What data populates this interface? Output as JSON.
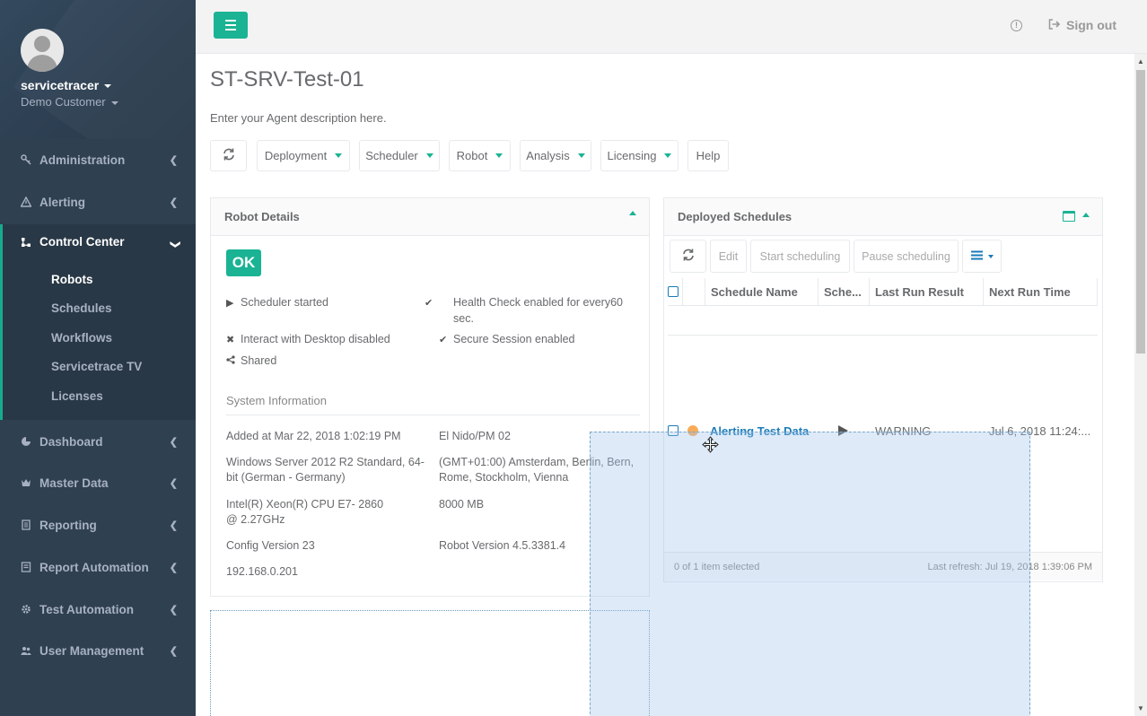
{
  "user": {
    "name": "servicetracer",
    "customer": "Demo Customer"
  },
  "nav": {
    "administration": "Administration",
    "alerting": "Alerting",
    "control_center": "Control Center",
    "control_center_items": [
      "Robots",
      "Schedules",
      "Workflows",
      "Servicetrace TV",
      "Licenses"
    ],
    "dashboard": "Dashboard",
    "master_data": "Master Data",
    "reporting": "Reporting",
    "report_automation": "Report Automation",
    "test_automation": "Test Automation",
    "user_management": "User Management"
  },
  "header": {
    "sign_out": "Sign out",
    "info_icon": "info-circle-icon",
    "signout_icon": "sign-out-icon"
  },
  "page": {
    "title": "ST-SRV-Test-01",
    "description": "Enter your Agent description here."
  },
  "toolbar": {
    "refresh_icon": "refresh-icon",
    "deployment": "Deployment",
    "scheduler": "Scheduler",
    "robot": "Robot",
    "analysis": "Analysis",
    "licensing": "Licensing",
    "help": "Help"
  },
  "robot_details": {
    "title": "Robot Details",
    "status": "OK",
    "scheduler_started": "Scheduler started",
    "health_check": "Health Check enabled for every60 sec.",
    "interact_desktop": "Interact with Desktop disabled",
    "secure_session": "Secure Session enabled",
    "shared": "Shared",
    "system_info_title": "System Information",
    "added_at": "Added at Mar 22, 2018 1:02:19 PM",
    "location": "El Nido/PM 02",
    "os": "Windows Server 2012 R2 Standard, 64-bit (German - Germany)",
    "timezone": "(GMT+01:00) Amsterdam, Berlin, Bern, Rome, Stockholm, Vienna",
    "cpu": "Intel(R) Xeon(R) CPU E7- 2860 @ 2.27GHz",
    "memory": "8000 MB",
    "config_version": "Config Version 23",
    "robot_version": "Robot Version 4.5.3381.4",
    "ip": "192.168.0.201"
  },
  "deployed_schedules": {
    "title": "Deployed Schedules",
    "buttons": {
      "edit": "Edit",
      "start": "Start scheduling",
      "pause": "Pause scheduling"
    },
    "columns": [
      "Schedule Name",
      "Sche...",
      "Last Run Result",
      "Next Run Time"
    ],
    "rows": [
      {
        "name": "Alerting Test Data",
        "state": "play",
        "last_run_result": "WARNING",
        "next_run_time": "Jul 6, 2018 11:24:..."
      }
    ],
    "footer_selected": "0 of 1 item selected",
    "footer_refresh": "Last refresh: Jul 19, 2018 1:39:06 PM"
  },
  "colors": {
    "accent": "#1ab394",
    "sidebar": "#2f4050",
    "link": "#1a7bb9",
    "warning": "#f8ac59"
  }
}
